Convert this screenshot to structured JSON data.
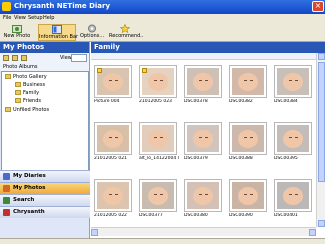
{
  "window": {
    "title": "Chrysanth NETime Diary",
    "close_glyph": "×"
  },
  "menu": [
    "File",
    "View",
    "Setup",
    "Help"
  ],
  "toolbar": [
    {
      "label": "New Photo",
      "icon": "new-photo-icon",
      "color": "#4a8a3a"
    },
    {
      "label": "Information Bar",
      "icon": "information-bar-icon",
      "color": "#3a6ad0",
      "active": true
    },
    {
      "label": "Options...",
      "icon": "options-icon",
      "color": "#7a7a7a"
    },
    {
      "label": "Recommend..",
      "icon": "recommend-icon",
      "color": "#f0c020"
    }
  ],
  "sidebar": {
    "title": "My Photos",
    "view_label": "View:",
    "albums_label": "Photo Albums",
    "tree": [
      {
        "label": "Photo Gallery",
        "level": 0
      },
      {
        "label": "Business",
        "level": 1
      },
      {
        "label": "Family",
        "level": 1
      },
      {
        "label": "Friends",
        "level": 1
      },
      {
        "label": "Unfiled Photos",
        "level": 0
      }
    ],
    "nav": [
      {
        "label": "My Diaries",
        "icon": "diary-icon",
        "color": "#4a6ad0"
      },
      {
        "label": "My Photos",
        "icon": "photos-icon",
        "color": "#d06a20",
        "active": true
      },
      {
        "label": "Search",
        "icon": "search-icon",
        "color": "#3a8a3a"
      },
      {
        "label": "Chrysanth",
        "icon": "chrysanth-icon",
        "color": "#c03030"
      }
    ]
  },
  "main": {
    "title": "Family",
    "photos": [
      {
        "caption": "Picture 004",
        "tone": "#d8c4b0",
        "badge": true
      },
      {
        "caption": "21012005 023",
        "tone": "#e6d2c0",
        "badge": true
      },
      {
        "caption": "DSC00378",
        "tone": "#cfc0b6"
      },
      {
        "caption": "DSC00382",
        "tone": "#d2b8a8"
      },
      {
        "caption": "DSC00384",
        "tone": "#c8c0b8"
      },
      {
        "caption": "21012005 021",
        "tone": "#d8c0a8"
      },
      {
        "caption": "alt_lo_14122004 024",
        "tone": "#e2ccbc"
      },
      {
        "caption": "DSC00379",
        "tone": "#d0c4bc"
      },
      {
        "caption": "DSC00388",
        "tone": "#cdb8ac"
      },
      {
        "caption": "DSC00395",
        "tone": "#c4bcb8"
      },
      {
        "caption": "21012005 022",
        "tone": "#dcc4ae"
      },
      {
        "caption": "DSC00377",
        "tone": "#c8bcb0"
      },
      {
        "caption": "DSC00380",
        "tone": "#d4c0b4"
      },
      {
        "caption": "DSC00390",
        "tone": "#c9b4a6"
      },
      {
        "caption": "DSC00401",
        "tone": "#bcb8b8"
      }
    ]
  }
}
